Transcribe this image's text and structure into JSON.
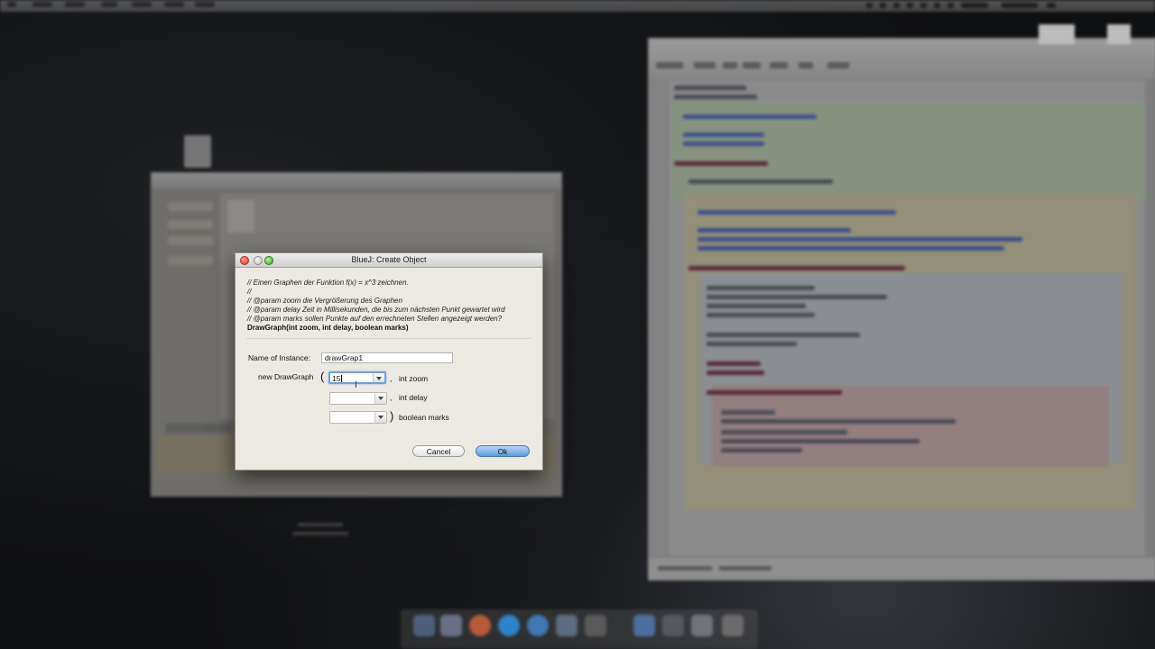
{
  "dialog": {
    "title": "BlueJ:  Create Object",
    "comments": [
      "// Einen Graphen der Funktion f(x) = x^3 zeichnen.",
      "//",
      "// @param zoom die Vergrößerung des Graphen",
      "// @param delay Zeit in Millisekunden, die bis zum nächsten Punkt gewartet wird",
      "// @param marks sollen Punkte auf den errechneten Stellen angezeigt werden?"
    ],
    "signature": "DrawGraph(int zoom, int delay, boolean marks)",
    "instance_label": "Name of Instance:",
    "instance_value": "drawGrap1",
    "constructor_label": "new DrawGraph",
    "open_paren": "(",
    "close_paren": ")",
    "params": [
      {
        "value": "15",
        "separator": ",",
        "type_label": "int zoom"
      },
      {
        "value": "",
        "separator": ",",
        "type_label": "int delay"
      },
      {
        "value": "",
        "separator": "",
        "type_label": "boolean marks"
      }
    ],
    "cancel_label": "Cancel",
    "ok_label": "Ok"
  },
  "colors": {
    "ok_button": "#5d9ae6",
    "dialog_bg": "#ece9e3",
    "close_light": "#d8362a",
    "zoom_light": "#3fa832"
  },
  "icons": {
    "traffic_lights": [
      "close-icon",
      "minimize-icon",
      "zoom-icon"
    ],
    "combo_arrow": "chevron-down-icon",
    "mouse": "text-cursor-icon"
  }
}
